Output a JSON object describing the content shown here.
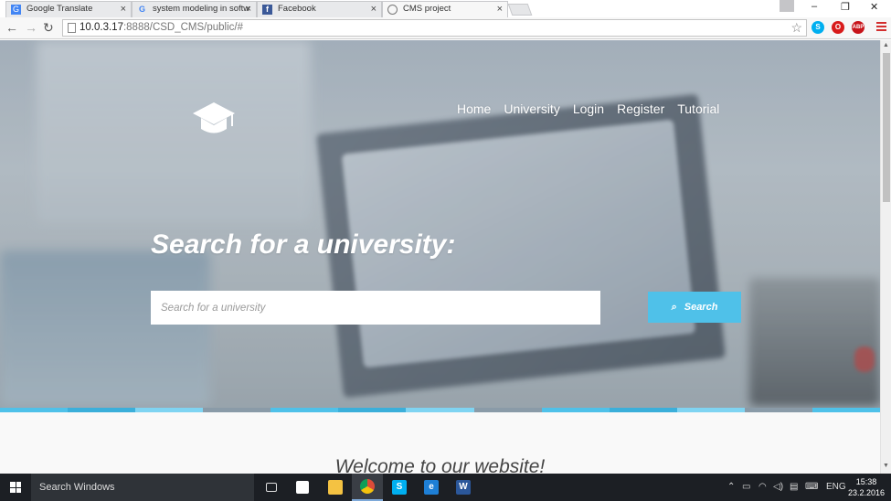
{
  "browser": {
    "tabs": [
      {
        "title": "Google Translate",
        "icon": "google-translate-icon",
        "icon_color": "#4285f4"
      },
      {
        "title": "system modeling in softw",
        "icon": "google-icon",
        "icon_color": "#4285f4"
      },
      {
        "title": "Facebook",
        "icon": "facebook-icon",
        "icon_color": "#3b5998"
      },
      {
        "title": "CMS project",
        "icon": "globe-icon",
        "icon_color": "#777777"
      }
    ],
    "url_host": "10.0.3.17",
    "url_rest": ":8888/CSD_CMS/public/#",
    "extensions": [
      {
        "name": "skype-ext-icon",
        "label": "S",
        "color": "#00aff0"
      },
      {
        "name": "opera-ext-icon",
        "label": "O",
        "color": "#d81b1b"
      },
      {
        "name": "adblock-ext-icon",
        "label": "ABP",
        "color": "#c7141a"
      }
    ]
  },
  "site": {
    "nav": [
      "Home",
      "University",
      "Login",
      "Register",
      "Tutorial"
    ],
    "hero_title": "Search for a university:",
    "search_placeholder": "Search for a university",
    "search_button": "Search",
    "stripe_colors": [
      "#4fc1e9",
      "#3bafda",
      "#7fd4f2",
      "#8a9ba8",
      "#4fc1e9",
      "#3bafda",
      "#7fd4f2",
      "#8a9ba8",
      "#4fc1e9",
      "#3bafda",
      "#7fd4f2",
      "#8a9ba8",
      "#4fc1e9"
    ],
    "welcome": "Welcome to our website!"
  },
  "taskbar": {
    "search_placeholder": "Search Windows",
    "apps": [
      {
        "name": "task-view-icon",
        "label": "",
        "color": "transparent",
        "active": false
      },
      {
        "name": "store-icon",
        "label": "",
        "color": "#ffffff",
        "active": false
      },
      {
        "name": "file-explorer-icon",
        "label": "",
        "color": "#f4c242",
        "active": false
      },
      {
        "name": "chrome-icon",
        "label": "",
        "color": "#dd4b39",
        "active": true
      },
      {
        "name": "skype-icon",
        "label": "S",
        "color": "#00aff0",
        "active": false
      },
      {
        "name": "edge-icon",
        "label": "e",
        "color": "#1e7fd6",
        "active": false
      },
      {
        "name": "word-icon",
        "label": "W",
        "color": "#2b579a",
        "active": false
      }
    ],
    "language": "ENG",
    "time": "15:38",
    "date": "23.2.2016"
  }
}
